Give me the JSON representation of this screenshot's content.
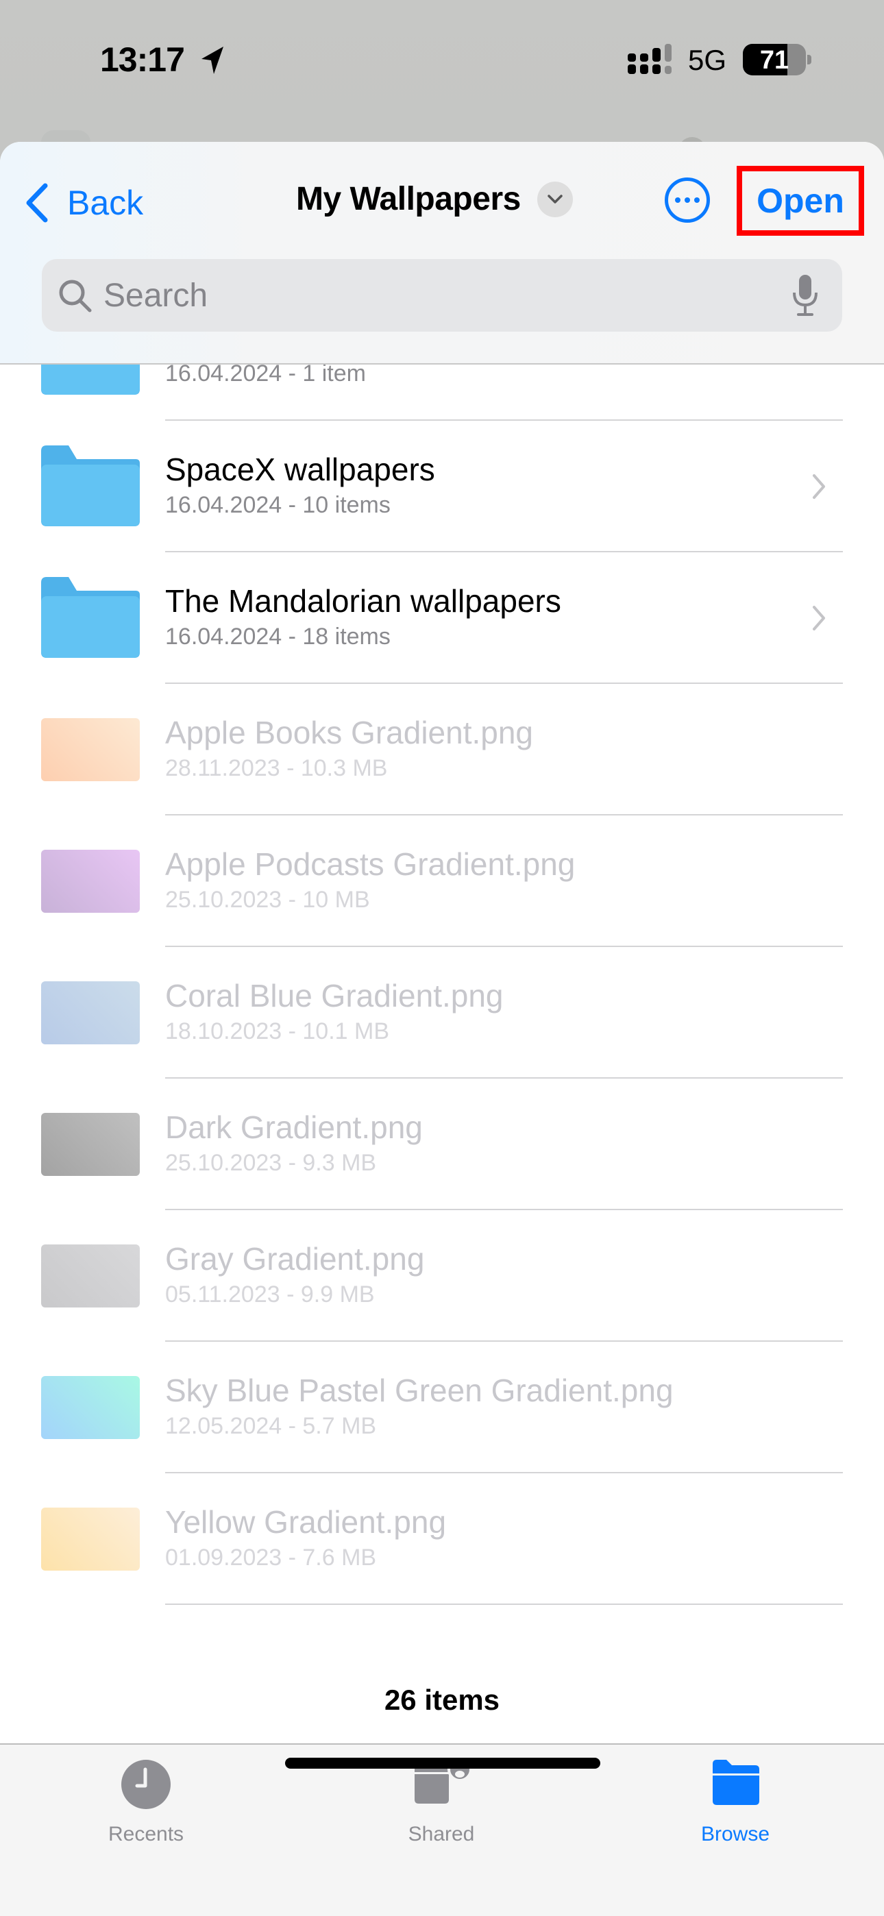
{
  "status_bar": {
    "time": "13:17",
    "network": "5G",
    "battery_percent": "71",
    "battery_level": 0.71,
    "signal_bars_active": 3,
    "signal_bars_total": 4
  },
  "nav": {
    "back_label": "Back",
    "title": "My Wallpapers",
    "open_label": "Open",
    "accent_color": "#0a7aff",
    "highlight_color": "#ff0000"
  },
  "search": {
    "placeholder": "Search",
    "value": ""
  },
  "items": [
    {
      "type": "folder",
      "name": "",
      "meta": "16.04.2024 - 1 item",
      "enabled": true
    },
    {
      "type": "folder",
      "name": "SpaceX wallpapers",
      "meta": "16.04.2024 - 10 items",
      "enabled": true
    },
    {
      "type": "folder",
      "name": "The Mandalorian wallpapers",
      "meta": "16.04.2024 - 18 items",
      "enabled": true
    },
    {
      "type": "file",
      "name": "Apple Books Gradient.png",
      "meta": "28.11.2023 - 10.3 MB",
      "enabled": false,
      "colors": [
        "#fdcfb0",
        "#fde9d3"
      ]
    },
    {
      "type": "file",
      "name": "Apple Podcasts Gradient.png",
      "meta": "25.10.2023 - 10 MB",
      "enabled": false,
      "colors": [
        "#c8b2d8",
        "#e8c6f4"
      ]
    },
    {
      "type": "file",
      "name": "Coral Blue Gradient.png",
      "meta": "18.10.2023 - 10.1 MB",
      "enabled": false,
      "colors": [
        "#b8cbe8",
        "#cbdcea"
      ]
    },
    {
      "type": "file",
      "name": "Dark Gradient.png",
      "meta": "25.10.2023 - 9.3 MB",
      "enabled": false,
      "colors": [
        "#a3a3a3",
        "#c0c0c0"
      ]
    },
    {
      "type": "file",
      "name": "Gray Gradient.png",
      "meta": "05.11.2023 - 9.9 MB",
      "enabled": false,
      "colors": [
        "#c9c9cb",
        "#d8d8da"
      ]
    },
    {
      "type": "file",
      "name": "Sky Blue Pastel Green Gradient.png",
      "meta": "12.05.2024 - 5.7 MB",
      "enabled": false,
      "colors": [
        "#a3d4fb",
        "#a9f8e4"
      ]
    },
    {
      "type": "file",
      "name": "Yellow Gradient.png",
      "meta": "01.09.2023 - 7.6 MB",
      "enabled": false,
      "colors": [
        "#fde2aa",
        "#fdeed8"
      ]
    }
  ],
  "footer": {
    "item_count": "26 items"
  },
  "tabbar": {
    "tabs": [
      {
        "label": "Recents",
        "icon": "clock-icon",
        "active": false
      },
      {
        "label": "Shared",
        "icon": "shared-folder-icon",
        "active": false
      },
      {
        "label": "Browse",
        "icon": "folder-icon",
        "active": true
      }
    ]
  }
}
